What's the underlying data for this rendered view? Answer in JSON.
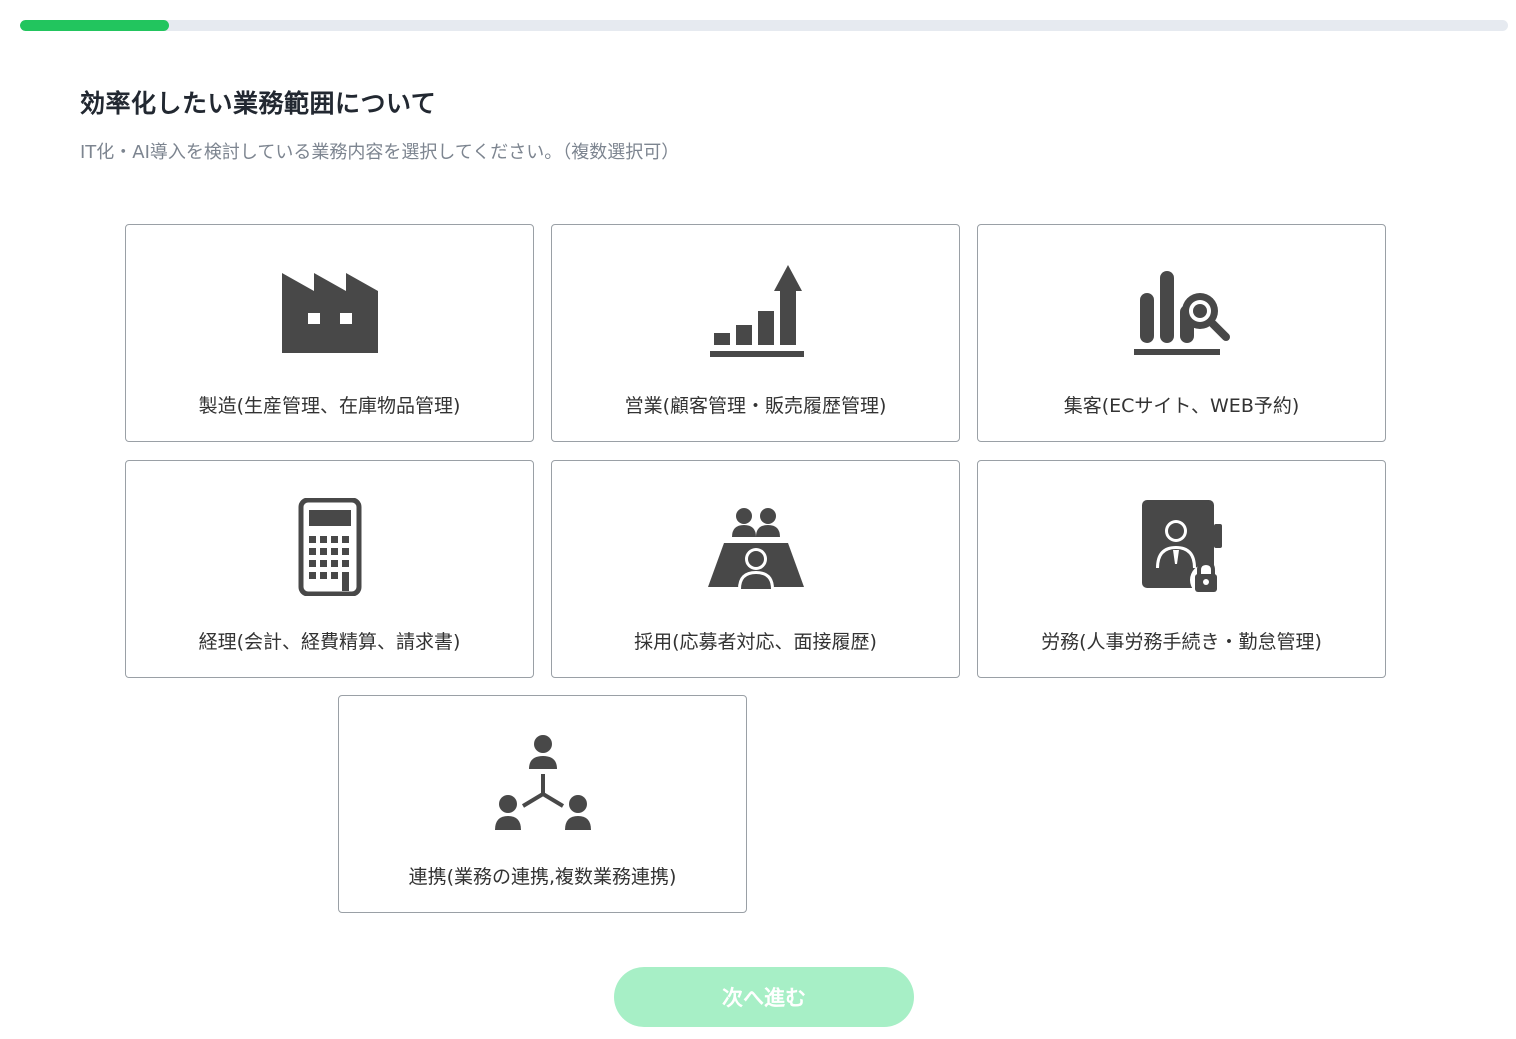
{
  "progress": {
    "fraction": 0.1,
    "color": "#22c55e"
  },
  "header": {
    "title": "効率化したい業務範囲について",
    "subtitle": "IT化・AI導入を検討している業務内容を選択してください。（複数選択可）"
  },
  "options": [
    {
      "label": "製造(生産管理、在庫物品管理)",
      "icon": "factory-icon"
    },
    {
      "label": "営業(顧客管理・販売履歴管理)",
      "icon": "growth-chart-icon"
    },
    {
      "label": "集客(ECサイト、WEB予約)",
      "icon": "chart-search-icon"
    },
    {
      "label": "経理(会計、経費精算、請求書)",
      "icon": "calculator-icon"
    },
    {
      "label": "採用(応募者対応、面接履歴)",
      "icon": "interview-icon"
    },
    {
      "label": "労務(人事労務手続き・勤怠管理)",
      "icon": "personnel-file-lock-icon"
    },
    {
      "label": "連携(業務の連携,複数業務連携)",
      "icon": "network-people-icon"
    }
  ],
  "footer": {
    "next_label": "次へ進む"
  },
  "colors": {
    "icon": "#484848",
    "button_disabled": "#a7efc6",
    "border": "#9aa0a6"
  }
}
